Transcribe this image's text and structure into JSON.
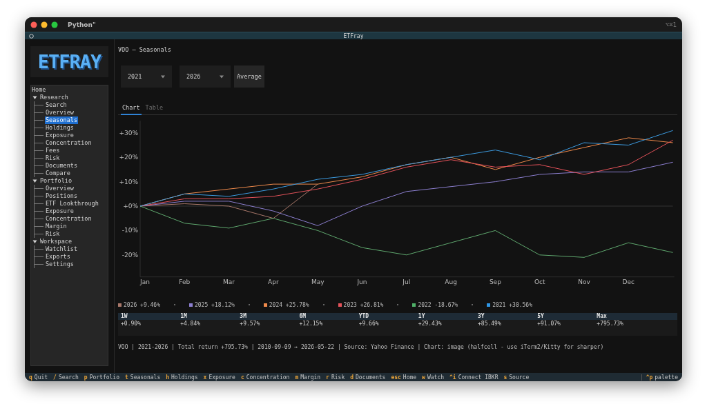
{
  "window": {
    "title": "Python\"",
    "shortcut": "⌥⌘1"
  },
  "tab_bar": {
    "title": "ETFray"
  },
  "logo": "ETFRAY",
  "sidebar": {
    "items": [
      {
        "label": "Home",
        "selected": false
      },
      {
        "label": "Research",
        "expanded": true,
        "selected": false,
        "children": [
          {
            "label": "Search",
            "selected": false
          },
          {
            "label": "Overview",
            "selected": false
          },
          {
            "label": "Seasonals",
            "selected": true
          },
          {
            "label": "Holdings",
            "selected": false
          },
          {
            "label": "Exposure",
            "selected": false
          },
          {
            "label": "Concentration",
            "selected": false
          },
          {
            "label": "Fees",
            "selected": false
          },
          {
            "label": "Risk",
            "selected": false
          },
          {
            "label": "Documents",
            "selected": false
          },
          {
            "label": "Compare",
            "selected": false
          }
        ]
      },
      {
        "label": "Portfolio",
        "expanded": true,
        "selected": false,
        "children": [
          {
            "label": "Overview",
            "selected": false
          },
          {
            "label": "Positions",
            "selected": false
          },
          {
            "label": "ETF Lookthrough",
            "selected": false
          },
          {
            "label": "Exposure",
            "selected": false
          },
          {
            "label": "Concentration",
            "selected": false
          },
          {
            "label": "Margin",
            "selected": false
          },
          {
            "label": "Risk",
            "selected": false
          }
        ]
      },
      {
        "label": "Workspace",
        "expanded": true,
        "selected": false,
        "children": [
          {
            "label": "Watchlist",
            "selected": false
          },
          {
            "label": "Exports",
            "selected": false
          },
          {
            "label": "Settings",
            "selected": false
          }
        ]
      }
    ]
  },
  "header": "VOO – Seasonals",
  "controls": {
    "selects": [
      {
        "value": "2021"
      },
      {
        "value": "2026"
      }
    ],
    "button": "Average"
  },
  "tabs": [
    {
      "label": "Chart",
      "selected": true
    },
    {
      "label": "Table",
      "selected": false
    }
  ],
  "chart_data": {
    "type": "line",
    "categories": [
      "Jan",
      "Feb",
      "Mar",
      "Apr",
      "May",
      "Jun",
      "Jul",
      "Aug",
      "Sep",
      "Oct",
      "Nov",
      "Dec",
      null
    ],
    "yticks": [
      {
        "value": 30,
        "label": "+30%"
      },
      {
        "value": 20,
        "label": "+20%"
      },
      {
        "value": 10,
        "label": "+10%"
      },
      {
        "value": 0,
        "label": "+0%"
      },
      {
        "value": -10,
        "label": "-10%"
      },
      {
        "value": -20,
        "label": "-20%"
      }
    ],
    "ylim": [
      -29,
      35
    ],
    "series": [
      {
        "name": "2026",
        "color": "#a9786a",
        "values": [
          0,
          1,
          0,
          -5,
          9,
          null,
          null,
          null,
          null,
          null,
          null,
          null,
          null
        ]
      },
      {
        "name": "2025",
        "color": "#8c7fd0",
        "values": [
          0,
          2,
          2,
          -2,
          -8,
          0,
          6,
          8,
          10,
          13,
          14,
          14,
          18
        ]
      },
      {
        "name": "2024",
        "color": "#f08a4b",
        "values": [
          0,
          5,
          7,
          9,
          9,
          12,
          17,
          20,
          15,
          20,
          24,
          28,
          26
        ]
      },
      {
        "name": "2023",
        "color": "#e5525a",
        "values": [
          0,
          3,
          3,
          4,
          7,
          11,
          16,
          19,
          16,
          17,
          13,
          17,
          27
        ]
      },
      {
        "name": "2022",
        "color": "#5fa86e",
        "values": [
          0,
          -7,
          -9,
          -5,
          -10,
          -17,
          -20,
          -15,
          -10,
          -20,
          -21,
          -15,
          -19
        ]
      },
      {
        "name": "2021",
        "color": "#3c9be0",
        "values": [
          0,
          5,
          4,
          7,
          11,
          13,
          17,
          20,
          23,
          19,
          26,
          25,
          31
        ]
      }
    ]
  },
  "legend": [
    {
      "change": "+9.46%",
      "color": "#a9786a"
    },
    {
      "change": "+18.12%",
      "color": "#8c7fd0"
    },
    {
      "change": "+25.78%",
      "color": "#f08a4b"
    },
    {
      "change": "+26.81%",
      "color": "#e5525a"
    },
    {
      "change": "-18.67%",
      "color": "#4fb068"
    },
    {
      "change": "+30.56%",
      "color": "#2f96e6"
    }
  ],
  "returns": {
    "columns": [
      "1W",
      "1M",
      "3M",
      "6M",
      "YTD",
      "1Y",
      "3Y",
      "5Y",
      "Max"
    ],
    "values": [
      "+0.90%",
      "+4.84%",
      "+9.57%",
      "+12.15%",
      "+9.66%",
      "+29.43%",
      "+85.49%",
      "+91.07%",
      "+795.73%"
    ]
  },
  "footer": "VOO | 2021-2026 | Total return +795.73% | 2010-09-09 → 2026-05-22 | Source: Yahoo Finance | Chart: image (halfcell - use iTerm2/Kitty for sharper)",
  "keybar": [
    {
      "key": "q",
      "label": "Quit"
    },
    {
      "key": "/",
      "label": "Search"
    },
    {
      "key": "p",
      "label": "Portfolio"
    },
    {
      "key": "t",
      "label": "Seasonals"
    },
    {
      "key": "h",
      "label": "Holdings"
    },
    {
      "key": "x",
      "label": "Exposure"
    },
    {
      "key": "c",
      "label": "Concentration"
    },
    {
      "key": "m",
      "label": "Margin"
    },
    {
      "key": "r",
      "label": "Risk"
    },
    {
      "key": "d",
      "label": "Documents"
    },
    {
      "key": "esc",
      "label": "Home"
    },
    {
      "key": "w",
      "label": "Watch"
    },
    {
      "key": "^i",
      "label": "Connect IBKR"
    },
    {
      "key": "s",
      "label": "Source"
    }
  ],
  "palette": {
    "key": "^p",
    "label": "palette"
  }
}
